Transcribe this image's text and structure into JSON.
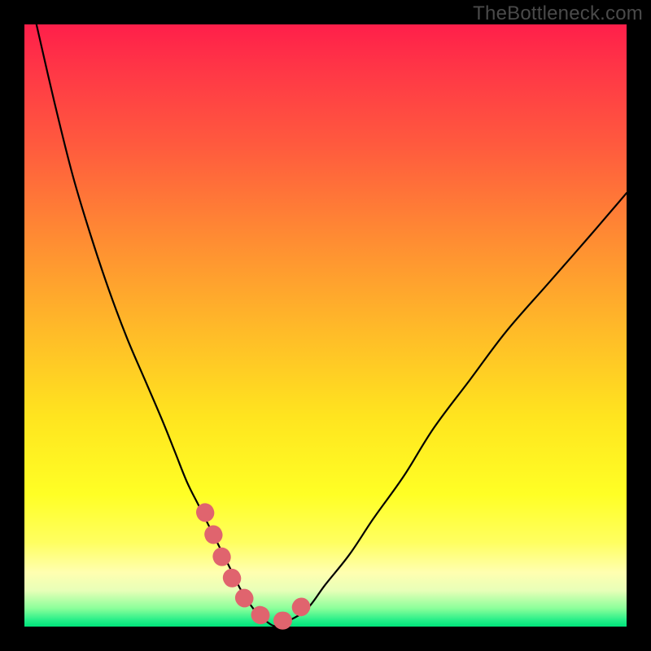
{
  "attribution": "TheBottleneck.com",
  "colors": {
    "frame": "#000000",
    "gradient_top": "#ff1f4a",
    "gradient_bottom": "#00e37a",
    "curve": "#000000",
    "marker": "#e0646e"
  },
  "chart_data": {
    "type": "line",
    "title": "",
    "xlabel": "",
    "ylabel": "",
    "xlim": [
      0,
      100
    ],
    "ylim": [
      0,
      100
    ],
    "grid": false,
    "legend": false,
    "series": [
      {
        "name": "bottleneck-curve",
        "x": [
          2,
          5,
          8,
          11,
          14,
          17,
          20,
          23,
          25,
          27,
          29,
          31,
          33,
          35,
          36,
          38,
          40,
          42,
          44,
          47,
          50,
          54,
          58,
          63,
          68,
          74,
          80,
          87,
          94,
          100
        ],
        "values": [
          100,
          87,
          75,
          65,
          56,
          48,
          41,
          34,
          29,
          24,
          20,
          16,
          12,
          8,
          6,
          3,
          1,
          0,
          1,
          3,
          7,
          12,
          18,
          25,
          33,
          41,
          49,
          57,
          65,
          72
        ]
      }
    ],
    "markers": {
      "name": "highlight-points",
      "x": [
        30,
        31.5,
        33,
        35,
        37,
        39,
        41,
        43,
        45,
        46.5,
        48
      ],
      "values": [
        19,
        15,
        11,
        7,
        4,
        2,
        1,
        1,
        2,
        4,
        6
      ]
    }
  }
}
